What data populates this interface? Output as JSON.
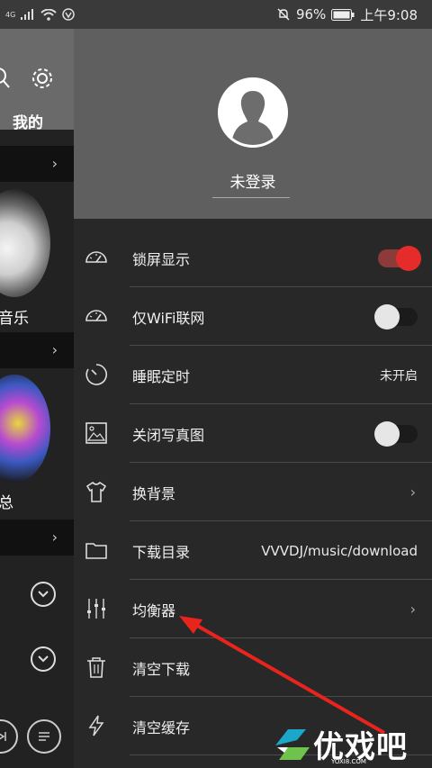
{
  "status_bar": {
    "network_label": "4G",
    "battery_percent": "96%",
    "time": "上午9:08"
  },
  "background_page": {
    "tab_label": "我的",
    "card1_label": "音乐",
    "card2_label": "总"
  },
  "drawer": {
    "login_text": "未登录",
    "items": [
      {
        "label": "锁屏显示",
        "icon": "gauge-icon",
        "control": "toggle",
        "on": true
      },
      {
        "label": "仅WiFi联网",
        "icon": "gauge-icon",
        "control": "toggle",
        "on": false
      },
      {
        "label": "睡眠定时",
        "icon": "timer-icon",
        "control": "value",
        "value": "未开启"
      },
      {
        "label": "关闭写真图",
        "icon": "image-icon",
        "control": "toggle",
        "on": false
      },
      {
        "label": "换背景",
        "icon": "tshirt-icon",
        "control": "arrow"
      },
      {
        "label": "下载目录",
        "icon": "folder-icon",
        "control": "value",
        "value": "VVVDJ/music/download"
      },
      {
        "label": "均衡器",
        "icon": "equalizer-icon",
        "control": "arrow"
      },
      {
        "label": "清空下载",
        "icon": "trash-icon",
        "control": "none"
      },
      {
        "label": "清空缓存",
        "icon": "lightning-icon",
        "control": "none"
      }
    ]
  },
  "watermark": {
    "brand": "优戏吧",
    "domain": "YOXI8.COM"
  },
  "colors": {
    "accent_red": "#e62b2b",
    "drawer_bg": "#282828",
    "header_bg": "#5f5f5f"
  }
}
